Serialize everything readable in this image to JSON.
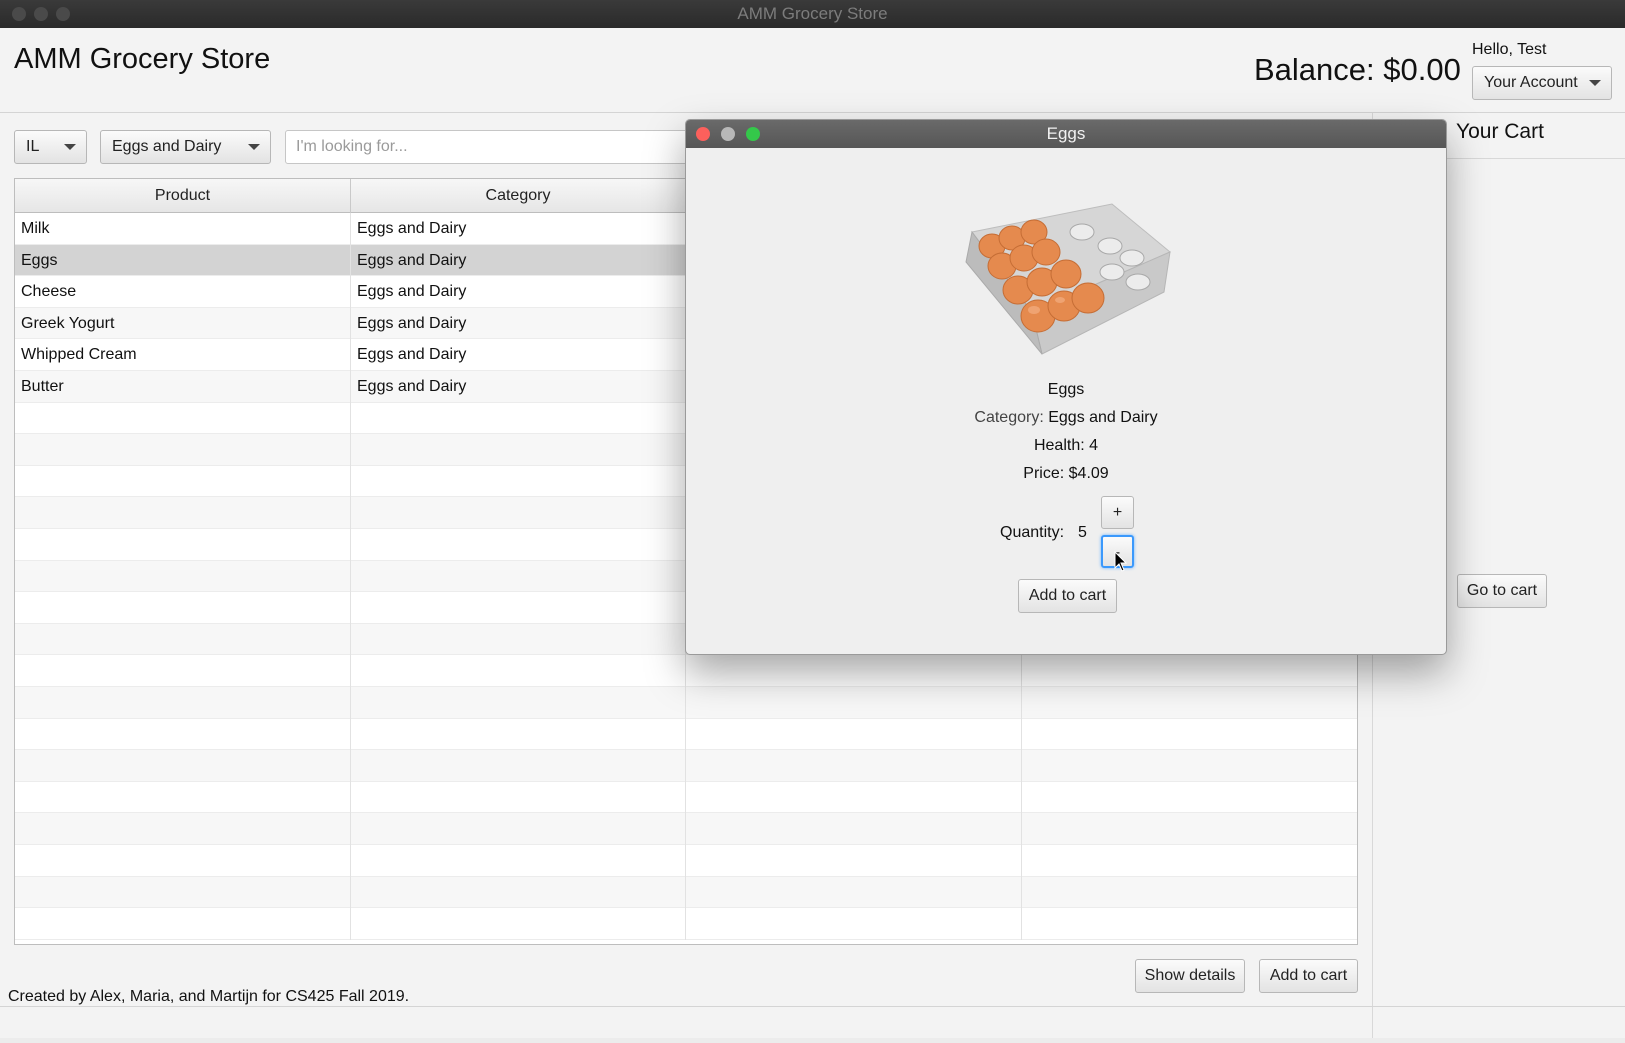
{
  "window": {
    "title": "AMM Grocery Store"
  },
  "header": {
    "app_title": "AMM Grocery Store",
    "balance": "Balance: $0.00",
    "greeting": "Hello, Test",
    "account_button": "Your Account"
  },
  "filters": {
    "state": "IL",
    "category": "Eggs and Dairy",
    "search_placeholder": "I'm looking for..."
  },
  "table": {
    "columns": [
      "Product",
      "Category"
    ],
    "rows": [
      {
        "product": "Milk",
        "category": "Eggs and Dairy"
      },
      {
        "product": "Eggs",
        "category": "Eggs and Dairy"
      },
      {
        "product": "Cheese",
        "category": "Eggs and Dairy"
      },
      {
        "product": "Greek Yogurt",
        "category": "Eggs and Dairy"
      },
      {
        "product": "Whipped Cream",
        "category": "Eggs and Dairy"
      },
      {
        "product": "Butter",
        "category": "Eggs and Dairy"
      }
    ],
    "selected_index": 1
  },
  "cart": {
    "title": "Your Cart",
    "go_to_cart": "Go to cart"
  },
  "actions": {
    "show_details": "Show details",
    "add_to_cart": "Add to cart"
  },
  "footer": {
    "text": "Created by Alex, Maria, and Martijn for CS425 Fall 2019."
  },
  "modal": {
    "title": "Eggs",
    "name": "Eggs",
    "category_label": "Category:",
    "category_value": "Eggs and Dairy",
    "health": "Health: 4",
    "price": "Price: $4.09",
    "quantity_label": "Quantity:",
    "quantity_value": "5",
    "plus": "+",
    "minus": "-",
    "add_to_cart": "Add to cart",
    "image_icon": "eggs-carton-image"
  },
  "colors": {
    "close": "#fc605c",
    "minimize": "#b8b8b8",
    "zoom": "#34c84a",
    "selected_row": "#d3d3d3",
    "focus": "#3b99fc"
  }
}
